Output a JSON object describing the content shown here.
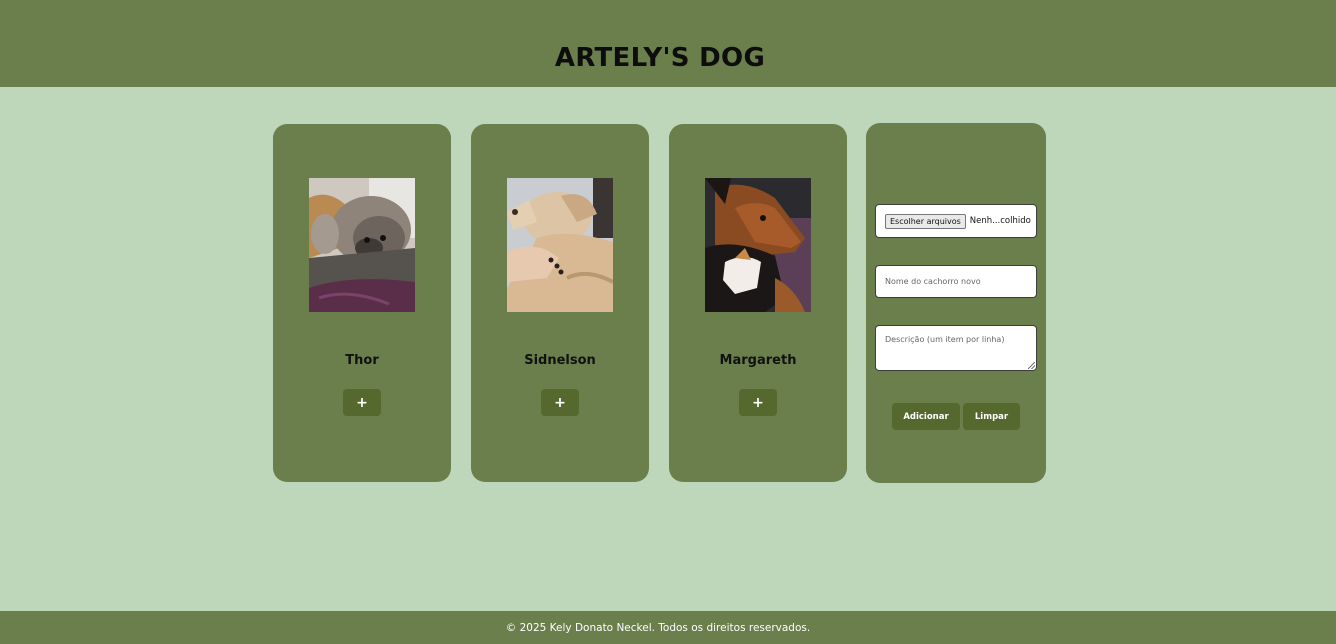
{
  "header": {
    "title": "ARTELY'S DOG"
  },
  "dogs": [
    {
      "name": "Thor",
      "add_label": "+",
      "photo": "thor-photo"
    },
    {
      "name": "Sidnelson",
      "add_label": "+",
      "photo": "sidnelson-photo"
    },
    {
      "name": "Margareth",
      "add_label": "+",
      "photo": "margareth-photo"
    }
  ],
  "form": {
    "file_button_label": "Escolher arquivos",
    "file_status": "Nenh...colhido",
    "name_placeholder": "Nome do cachorro novo",
    "description_placeholder": "Descrição (um item por linha)",
    "add_label": "Adicionar",
    "clear_label": "Limpar"
  },
  "footer": {
    "text": "© 2025 Kely Donato Neckel. Todos os direitos reservados."
  },
  "colors": {
    "header_bg": "#6a7f4b",
    "page_bg": "#bed7bb",
    "card_bg": "#6a7f4b",
    "button_bg": "#55682d"
  }
}
